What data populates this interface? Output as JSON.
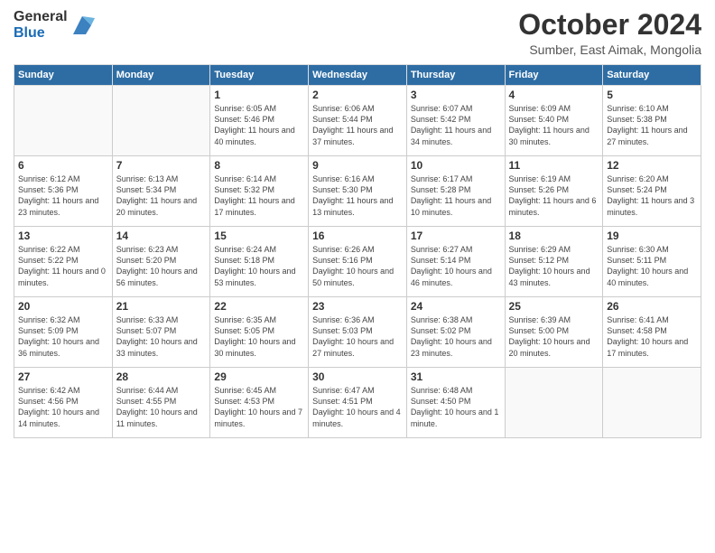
{
  "header": {
    "logo_general": "General",
    "logo_blue": "Blue",
    "title": "October 2024",
    "subtitle": "Sumber, East Aimak, Mongolia"
  },
  "days_of_week": [
    "Sunday",
    "Monday",
    "Tuesday",
    "Wednesday",
    "Thursday",
    "Friday",
    "Saturday"
  ],
  "weeks": [
    [
      {
        "day": "",
        "info": ""
      },
      {
        "day": "",
        "info": ""
      },
      {
        "day": "1",
        "info": "Sunrise: 6:05 AM\nSunset: 5:46 PM\nDaylight: 11 hours and 40 minutes."
      },
      {
        "day": "2",
        "info": "Sunrise: 6:06 AM\nSunset: 5:44 PM\nDaylight: 11 hours and 37 minutes."
      },
      {
        "day": "3",
        "info": "Sunrise: 6:07 AM\nSunset: 5:42 PM\nDaylight: 11 hours and 34 minutes."
      },
      {
        "day": "4",
        "info": "Sunrise: 6:09 AM\nSunset: 5:40 PM\nDaylight: 11 hours and 30 minutes."
      },
      {
        "day": "5",
        "info": "Sunrise: 6:10 AM\nSunset: 5:38 PM\nDaylight: 11 hours and 27 minutes."
      }
    ],
    [
      {
        "day": "6",
        "info": "Sunrise: 6:12 AM\nSunset: 5:36 PM\nDaylight: 11 hours and 23 minutes."
      },
      {
        "day": "7",
        "info": "Sunrise: 6:13 AM\nSunset: 5:34 PM\nDaylight: 11 hours and 20 minutes."
      },
      {
        "day": "8",
        "info": "Sunrise: 6:14 AM\nSunset: 5:32 PM\nDaylight: 11 hours and 17 minutes."
      },
      {
        "day": "9",
        "info": "Sunrise: 6:16 AM\nSunset: 5:30 PM\nDaylight: 11 hours and 13 minutes."
      },
      {
        "day": "10",
        "info": "Sunrise: 6:17 AM\nSunset: 5:28 PM\nDaylight: 11 hours and 10 minutes."
      },
      {
        "day": "11",
        "info": "Sunrise: 6:19 AM\nSunset: 5:26 PM\nDaylight: 11 hours and 6 minutes."
      },
      {
        "day": "12",
        "info": "Sunrise: 6:20 AM\nSunset: 5:24 PM\nDaylight: 11 hours and 3 minutes."
      }
    ],
    [
      {
        "day": "13",
        "info": "Sunrise: 6:22 AM\nSunset: 5:22 PM\nDaylight: 11 hours and 0 minutes."
      },
      {
        "day": "14",
        "info": "Sunrise: 6:23 AM\nSunset: 5:20 PM\nDaylight: 10 hours and 56 minutes."
      },
      {
        "day": "15",
        "info": "Sunrise: 6:24 AM\nSunset: 5:18 PM\nDaylight: 10 hours and 53 minutes."
      },
      {
        "day": "16",
        "info": "Sunrise: 6:26 AM\nSunset: 5:16 PM\nDaylight: 10 hours and 50 minutes."
      },
      {
        "day": "17",
        "info": "Sunrise: 6:27 AM\nSunset: 5:14 PM\nDaylight: 10 hours and 46 minutes."
      },
      {
        "day": "18",
        "info": "Sunrise: 6:29 AM\nSunset: 5:12 PM\nDaylight: 10 hours and 43 minutes."
      },
      {
        "day": "19",
        "info": "Sunrise: 6:30 AM\nSunset: 5:11 PM\nDaylight: 10 hours and 40 minutes."
      }
    ],
    [
      {
        "day": "20",
        "info": "Sunrise: 6:32 AM\nSunset: 5:09 PM\nDaylight: 10 hours and 36 minutes."
      },
      {
        "day": "21",
        "info": "Sunrise: 6:33 AM\nSunset: 5:07 PM\nDaylight: 10 hours and 33 minutes."
      },
      {
        "day": "22",
        "info": "Sunrise: 6:35 AM\nSunset: 5:05 PM\nDaylight: 10 hours and 30 minutes."
      },
      {
        "day": "23",
        "info": "Sunrise: 6:36 AM\nSunset: 5:03 PM\nDaylight: 10 hours and 27 minutes."
      },
      {
        "day": "24",
        "info": "Sunrise: 6:38 AM\nSunset: 5:02 PM\nDaylight: 10 hours and 23 minutes."
      },
      {
        "day": "25",
        "info": "Sunrise: 6:39 AM\nSunset: 5:00 PM\nDaylight: 10 hours and 20 minutes."
      },
      {
        "day": "26",
        "info": "Sunrise: 6:41 AM\nSunset: 4:58 PM\nDaylight: 10 hours and 17 minutes."
      }
    ],
    [
      {
        "day": "27",
        "info": "Sunrise: 6:42 AM\nSunset: 4:56 PM\nDaylight: 10 hours and 14 minutes."
      },
      {
        "day": "28",
        "info": "Sunrise: 6:44 AM\nSunset: 4:55 PM\nDaylight: 10 hours and 11 minutes."
      },
      {
        "day": "29",
        "info": "Sunrise: 6:45 AM\nSunset: 4:53 PM\nDaylight: 10 hours and 7 minutes."
      },
      {
        "day": "30",
        "info": "Sunrise: 6:47 AM\nSunset: 4:51 PM\nDaylight: 10 hours and 4 minutes."
      },
      {
        "day": "31",
        "info": "Sunrise: 6:48 AM\nSunset: 4:50 PM\nDaylight: 10 hours and 1 minute."
      },
      {
        "day": "",
        "info": ""
      },
      {
        "day": "",
        "info": ""
      }
    ]
  ]
}
